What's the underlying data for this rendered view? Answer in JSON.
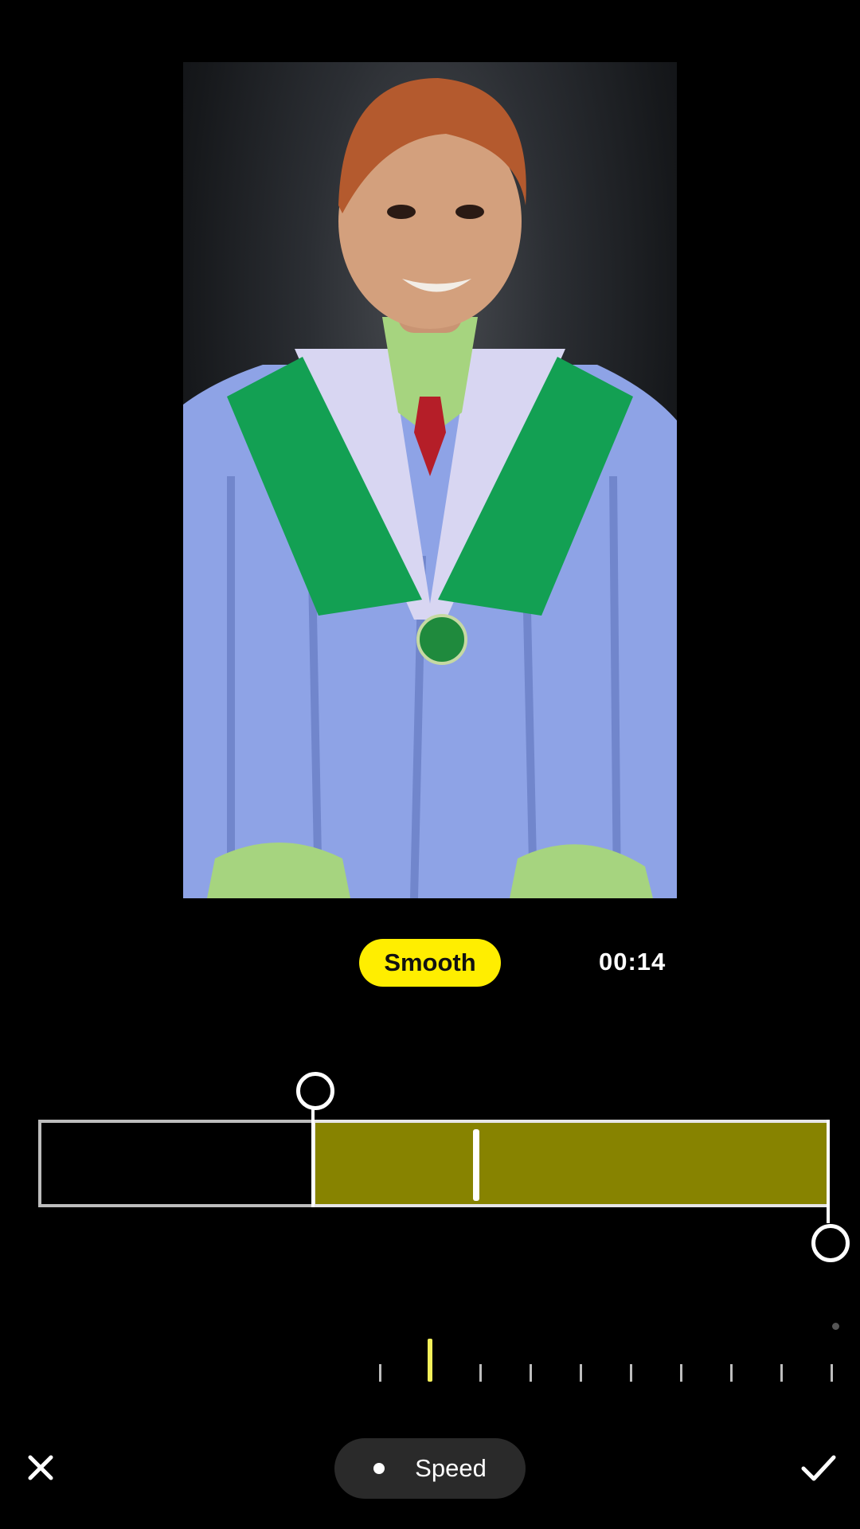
{
  "status": {
    "mode_label": "Smooth",
    "time": "00:14"
  },
  "toolbar": {
    "speed_label": "Speed",
    "close_icon": "close-icon",
    "confirm_icon": "check-icon"
  },
  "colors": {
    "accent": "#ffee00",
    "selection": "#878300"
  }
}
